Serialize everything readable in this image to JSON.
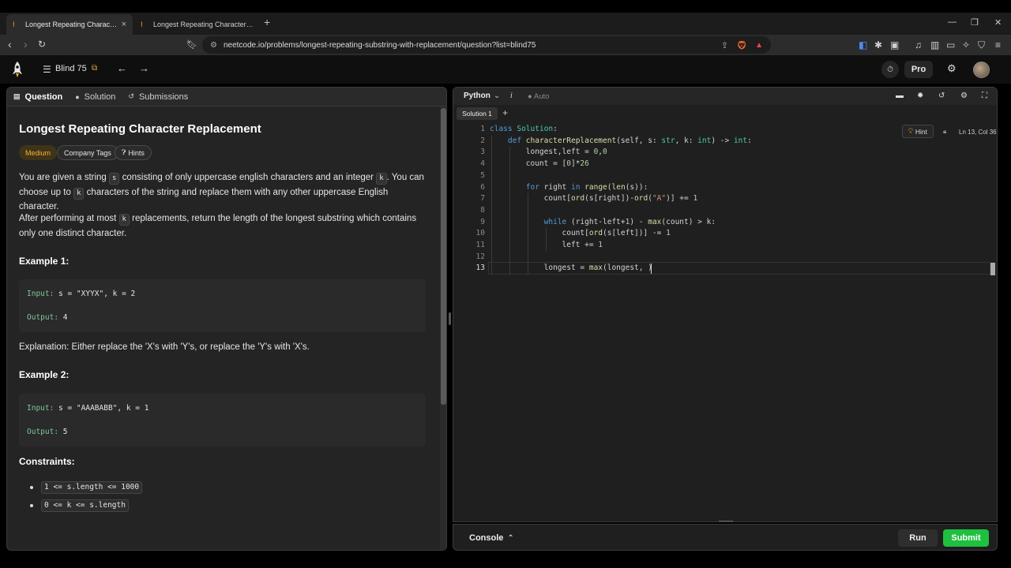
{
  "browser": {
    "tabs": [
      {
        "title": "Longest Repeating Character Re",
        "active": true
      },
      {
        "title": "Longest Repeating Character Replace",
        "active": false
      }
    ],
    "url": "neetcode.io/problems/longest-repeating-substring-with-replacement/question?list=blind75"
  },
  "header": {
    "list_label": "Blind 75",
    "pro_label": "Pro"
  },
  "left": {
    "tabs": [
      "Question",
      "Solution",
      "Submissions"
    ],
    "title": "Longest Repeating Character Replacement",
    "pills": [
      "Medium",
      "Company Tags",
      "Hints"
    ],
    "desc1": {
      "a": "You are given a string ",
      "s": "s",
      "b": " consisting of only uppercase english characters and an integer ",
      "k": "k",
      "c": ". You can",
      "d": "choose up to ",
      "k2": "k",
      "e": " characters of the string and replace them with any other uppercase English character."
    },
    "desc2": {
      "a": "After performing at most ",
      "k": "k",
      "b": " replacements, return the length of the longest substring which contains",
      "c": "only one distinct character."
    },
    "ex1_title": "Example 1:",
    "ex1_input_label": "Input:",
    "ex1_input": " s = \"XYYX\", k = 2",
    "ex1_output_label": "Output:",
    "ex1_output": " 4",
    "explanation": "Explanation: Either replace the 'X's with 'Y's, or replace the 'Y's with 'X's.",
    "ex2_title": "Example 2:",
    "ex2_input_label": "Input:",
    "ex2_input": " s = \"AAABABB\", k = 1",
    "ex2_output_label": "Output:",
    "ex2_output": " 5",
    "constraints_title": "Constraints:",
    "constraints": [
      "1 <= s.length <= 1000",
      "0 <= k <= s.length"
    ]
  },
  "editor": {
    "language": "Python",
    "info": "i",
    "auto": "Auto",
    "solution_tab": "Solution 1",
    "hint": "Hint",
    "cursor_pos": "Ln 13, Col 36",
    "line_numbers": [
      "1",
      "2",
      "3",
      "4",
      "5",
      "6",
      "7",
      "8",
      "9",
      "10",
      "11",
      "12",
      "13"
    ],
    "code_lines": [
      "class Solution:",
      "    def characterReplacement(self, s: str, k: int) -> int:",
      "        longest,left = 0,0",
      "        count = [0]*26",
      "",
      "        for right in range(len(s)):",
      "            count[ord(s[right])-ord(\"A\")] += 1",
      "",
      "            while (right-left+1) - max(count) > k:",
      "                count[ord(s[left])] -= 1",
      "                left += 1",
      "",
      "            longest = max(longest, )"
    ]
  },
  "console": {
    "label": "Console",
    "run": "Run",
    "submit": "Submit"
  },
  "colors": {
    "accent_green": "#1fbf3f",
    "medium_badge": "#f2b33d",
    "keyword": "#569cd6"
  }
}
